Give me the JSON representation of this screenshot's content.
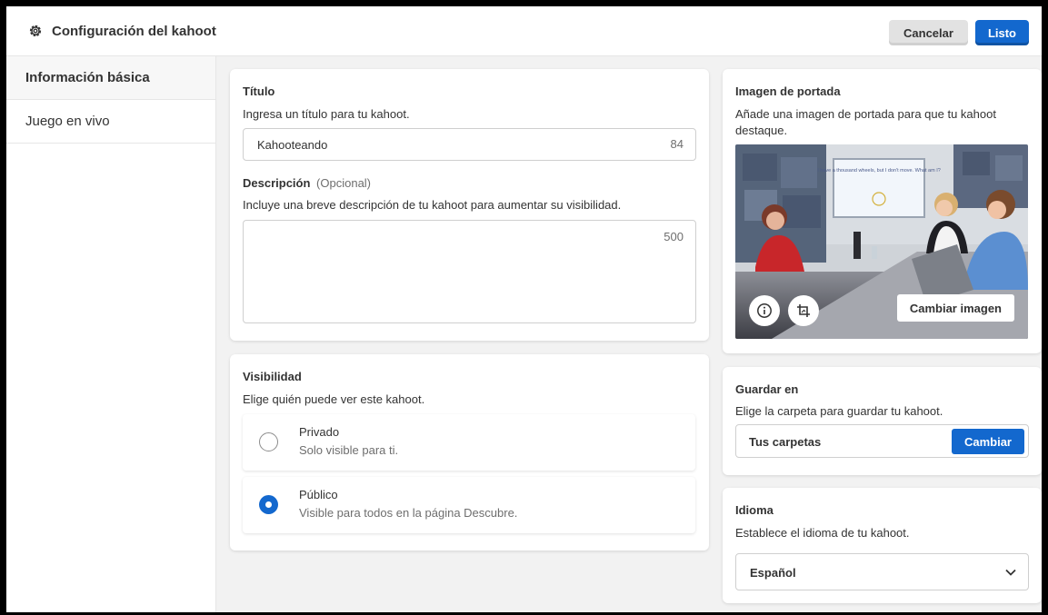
{
  "header": {
    "title": "Configuración del kahoot",
    "cancel_label": "Cancelar",
    "done_label": "Listo"
  },
  "sidebar": {
    "items": [
      {
        "label": "Información básica",
        "active": true
      },
      {
        "label": "Juego en vivo",
        "active": false
      }
    ]
  },
  "title_section": {
    "heading": "Título",
    "hint": "Ingresa un título para tu kahoot.",
    "value": "Kahooteando",
    "counter": "84"
  },
  "description_section": {
    "heading": "Descripción",
    "optional": "(Opcional)",
    "hint": "Incluye una breve descripción de tu kahoot para aumentar su visibilidad.",
    "value": "",
    "counter": "500"
  },
  "visibility": {
    "heading": "Visibilidad",
    "hint": "Elige quién puede ver este kahoot.",
    "options": [
      {
        "label": "Privado",
        "description": "Solo visible para ti.",
        "selected": false
      },
      {
        "label": "Público",
        "description": "Visible para todos en la página Descubre.",
        "selected": true
      }
    ]
  },
  "cover": {
    "heading": "Imagen de portada",
    "hint": "Añade una imagen de portada para que tu kahoot destaque.",
    "screen_text": "I have a thousand wheels, but I don't move. What am I?",
    "change_label": "Cambiar imagen",
    "info_icon": "info-icon",
    "crop_icon": "crop-icon"
  },
  "save_to": {
    "heading": "Guardar en",
    "hint": "Elige la carpeta para guardar tu kahoot.",
    "folder": "Tus carpetas",
    "change_label": "Cambiar"
  },
  "language": {
    "heading": "Idioma",
    "hint": "Establece el idioma de tu kahoot.",
    "selected": "Español",
    "chevron_icon": "chevron-down-icon"
  },
  "colors": {
    "primary": "#1368ce",
    "frame": "#000000",
    "background": "#f2f2f2"
  }
}
